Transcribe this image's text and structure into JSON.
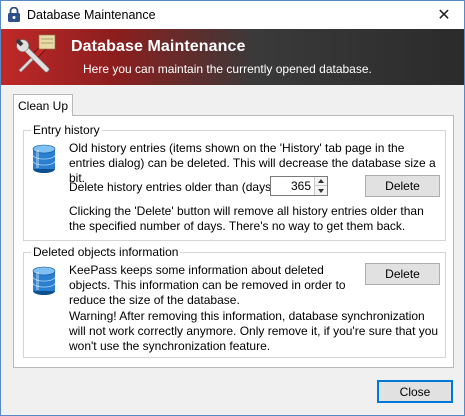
{
  "window": {
    "title": "Database Maintenance",
    "close_glyph": "✕"
  },
  "banner": {
    "title": "Database Maintenance",
    "subtitle": "Here you can maintain the currently opened database.",
    "icon": "tools-icon"
  },
  "tabs": [
    {
      "label": "Clean Up",
      "selected": true
    }
  ],
  "entry_history": {
    "title": "Entry history",
    "description": "Old history entries (items shown on the 'History' tab page in the entries dialog) can be deleted. This will decrease the database size a bit.",
    "days_label": "Delete history entries older than (days):",
    "days_value": "365",
    "delete_label": "Delete",
    "note": "Clicking the 'Delete' button will remove all history entries older than the specified number of days. There's no way to get them back.",
    "icon": "database-icon"
  },
  "deleted_objects": {
    "title": "Deleted objects information",
    "description": "KeePass keeps some information about deleted objects. This information can be removed in order to reduce the size of the database.",
    "delete_label": "Delete",
    "warning": "Warning! After removing this information, database synchronization will not work correctly anymore. Only remove it, if you're sure that you won't use the synchronization feature.",
    "icon": "database-icon"
  },
  "footer": {
    "close_label": "Close"
  },
  "colors": {
    "banner_left": "#c02828",
    "banner_right": "#2b2b2b",
    "accent": "#0078d7"
  }
}
